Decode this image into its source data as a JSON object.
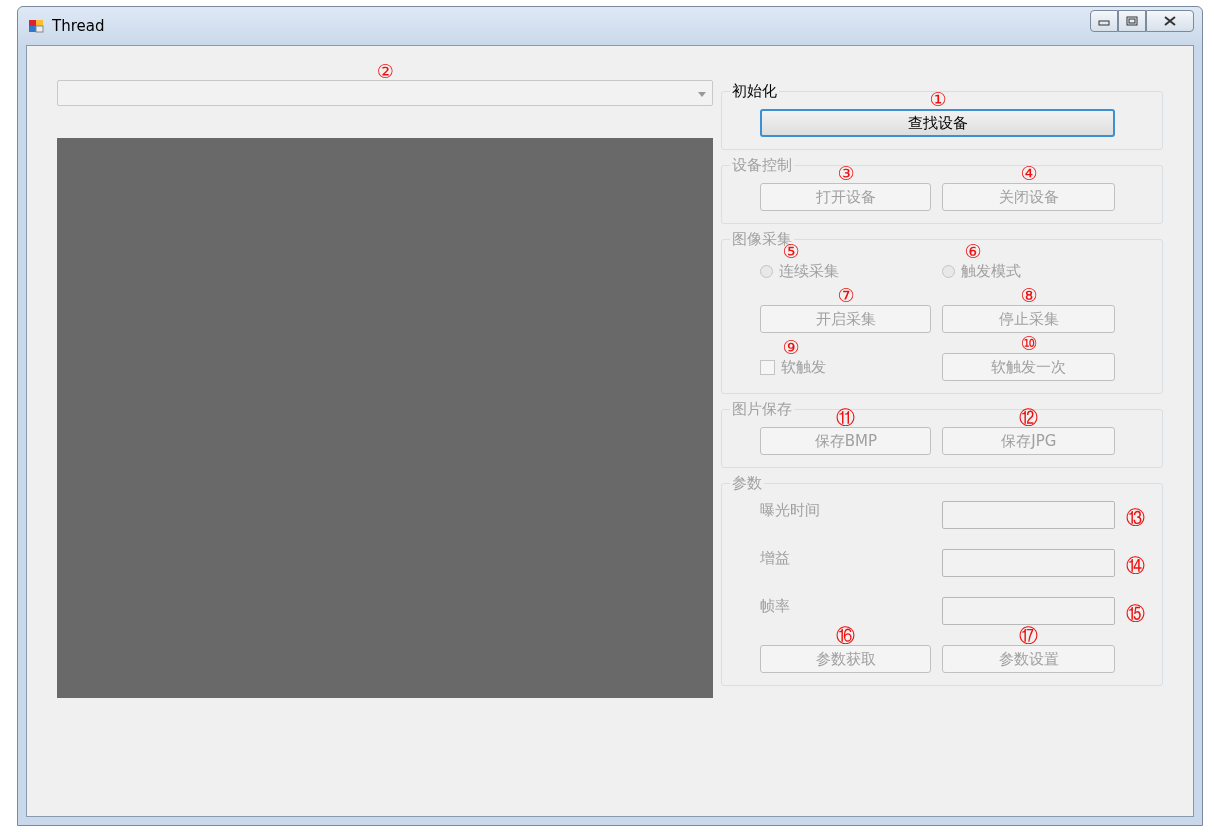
{
  "window": {
    "title": "Thread"
  },
  "device_combo": {
    "mark": "②"
  },
  "groups": [
    {
      "title": "初始化",
      "disabled": false,
      "rows": [
        [
          {
            "kind": "button",
            "label": "查找设备",
            "mark": "①",
            "focused": true
          }
        ]
      ]
    },
    {
      "title": "设备控制",
      "disabled": true,
      "rows": [
        [
          {
            "kind": "button",
            "label": "打开设备",
            "mark": "③"
          },
          {
            "kind": "button",
            "label": "关闭设备",
            "mark": "④"
          }
        ]
      ]
    },
    {
      "title": "图像采集",
      "disabled": true,
      "rows": [
        [
          {
            "kind": "radio",
            "label": "连续采集",
            "mark": "⑤",
            "selected": false
          },
          {
            "kind": "radio",
            "label": "触发模式",
            "mark": "⑥",
            "selected": false
          }
        ],
        [
          {
            "kind": "button",
            "label": "开启采集",
            "mark": "⑦"
          },
          {
            "kind": "button",
            "label": "停止采集",
            "mark": "⑧"
          }
        ],
        [
          {
            "kind": "checkbox",
            "label": "软触发",
            "mark": "⑨",
            "checked": false
          },
          {
            "kind": "button",
            "label": "软触发一次",
            "mark": "⑩"
          }
        ]
      ]
    },
    {
      "title": "图片保存",
      "disabled": true,
      "rows": [
        [
          {
            "kind": "button",
            "label": "保存BMP",
            "mark": "⑪"
          },
          {
            "kind": "button",
            "label": "保存JPG",
            "mark": "⑫"
          }
        ]
      ]
    },
    {
      "title": "参数",
      "disabled": true,
      "rows": [
        [
          {
            "kind": "label",
            "label": "曝光时间"
          },
          {
            "kind": "field",
            "mark": "⑬"
          }
        ],
        [
          {
            "kind": "label",
            "label": "增益"
          },
          {
            "kind": "field",
            "mark": "⑭"
          }
        ],
        [
          {
            "kind": "label",
            "label": "帧率"
          },
          {
            "kind": "field",
            "mark": "⑮"
          }
        ],
        [
          {
            "kind": "button",
            "label": "参数获取",
            "mark": "⑯"
          },
          {
            "kind": "button",
            "label": "参数设置",
            "mark": "⑰"
          }
        ]
      ]
    }
  ]
}
